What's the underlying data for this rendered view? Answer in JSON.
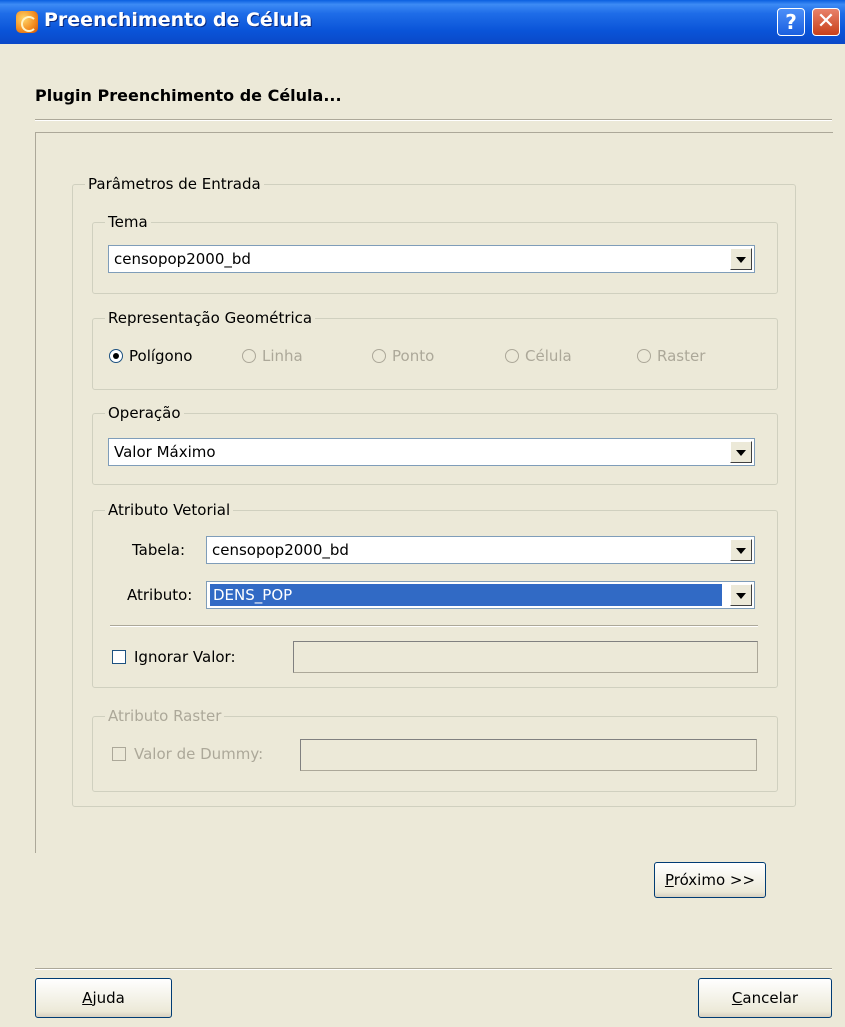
{
  "window": {
    "title": "Preenchimento de Célula",
    "help_glyph": "?",
    "close_glyph": "✕"
  },
  "header": {
    "title": "Plugin Preenchimento de Célula..."
  },
  "entrada": {
    "legend": "Parâmetros de Entrada",
    "tema": {
      "legend": "Tema",
      "value": "censopop2000_bd"
    },
    "representacao": {
      "legend": "Representação Geométrica",
      "options": [
        "Polígono",
        "Linha",
        "Ponto",
        "Célula",
        "Raster"
      ],
      "selected": "Polígono"
    },
    "operacao": {
      "legend": "Operação",
      "value": "Valor Máximo"
    },
    "vetorial": {
      "legend": "Atributo Vetorial",
      "tabela_label": "Tabela:",
      "tabela_value": "censopop2000_bd",
      "atributo_label": "Atributo:",
      "atributo_value": "DENS_POP",
      "ignorar_label": "Ignorar Valor:",
      "ignorar_value": ""
    },
    "raster": {
      "legend": "Atributo Raster",
      "dummy_label": "Valor de Dummy:",
      "dummy_value": ""
    }
  },
  "buttons": {
    "proximo_first": "P",
    "proximo_rest": "róximo >>",
    "ajuda_first": "A",
    "ajuda_rest": "juda",
    "cancelar_first": "C",
    "cancelar_rest": "ancelar"
  }
}
